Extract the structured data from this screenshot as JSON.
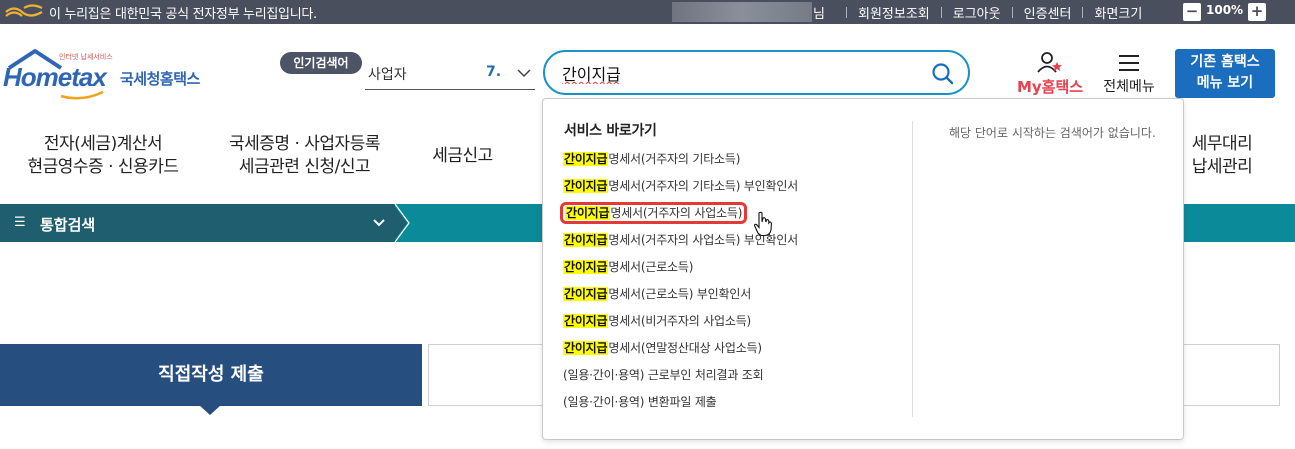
{
  "gov_banner": {
    "text": "이 누리집은 대한민국 공식 전자정부 누리집입니다.",
    "user_suffix": "님",
    "links": [
      "회원정보조회",
      "로그아웃",
      "인증센터",
      "화면크기"
    ],
    "zoom_minus": "−",
    "zoom_value": "100%",
    "zoom_plus": "+"
  },
  "header": {
    "logo_small": "인터넷 납세서비스",
    "logo_main": "Hometax",
    "logo_kr": "국세청홈택스",
    "hot_badge": "인기검색어",
    "hot_word": "사업자",
    "hot_rank": "7.",
    "search_value": "간이지급",
    "my_label": "My홈택스",
    "allmenu_label": "전체메뉴",
    "old_btn_line1": "기존 홈택스",
    "old_btn_line2": "메뉴 보기"
  },
  "nav": [
    {
      "line1": "전자(세금)계산서",
      "line2": "현금영수증 · 신용카드"
    },
    {
      "line1": "국세증명 · 사업자등록",
      "line2": "세금관련 신청/신고"
    },
    {
      "line1": "세금신고",
      "line2": ""
    },
    {
      "line1": "세무대리",
      "line2": "납세관리"
    }
  ],
  "teal_bar": {
    "label": "통합검색",
    "menu_glyph": "☰"
  },
  "lower": {
    "submit_tab": "직접작성 제출"
  },
  "dropdown": {
    "title": "서비스 바로가기",
    "no_result": "해당 단어로 시작하는 검색어가 없습니다.",
    "highlight": "간이지급",
    "items": [
      {
        "prefix": "간이지급",
        "rest": "명세서(거주자의 기타소득)"
      },
      {
        "prefix": "간이지급",
        "rest": "명세서(거주자의 기타소득) 부인확인서"
      },
      {
        "prefix": "간이지급",
        "rest": "명세서(거주자의 사업소득)"
      },
      {
        "prefix": "간이지급",
        "rest": "명세서(거주자의 사업소득) 부인확인서"
      },
      {
        "prefix": "간이지급",
        "rest": "명세서(근로소득)"
      },
      {
        "prefix": "간이지급",
        "rest": "명세서(근로소득) 부인확인서"
      },
      {
        "prefix": "간이지급",
        "rest": "명세서(비거주자의 사업소득)"
      },
      {
        "prefix": "간이지급",
        "rest": "명세서(연말정산대상 사업소득)"
      },
      {
        "prefix": "",
        "rest": "(일용·간이·용역) 근로부인 처리결과 조회"
      },
      {
        "prefix": "",
        "rest": "(일용·간이·용역) 변환파일 제출"
      }
    ]
  },
  "colors": {
    "gov_bar": "#4a4f5e",
    "brand_blue": "#2e65b5",
    "search_border": "#1a92c8",
    "teal": "#0b8a99",
    "submit_tab": "#264f80",
    "highlight": "#ffff00",
    "selection_outline": "#e53935"
  }
}
